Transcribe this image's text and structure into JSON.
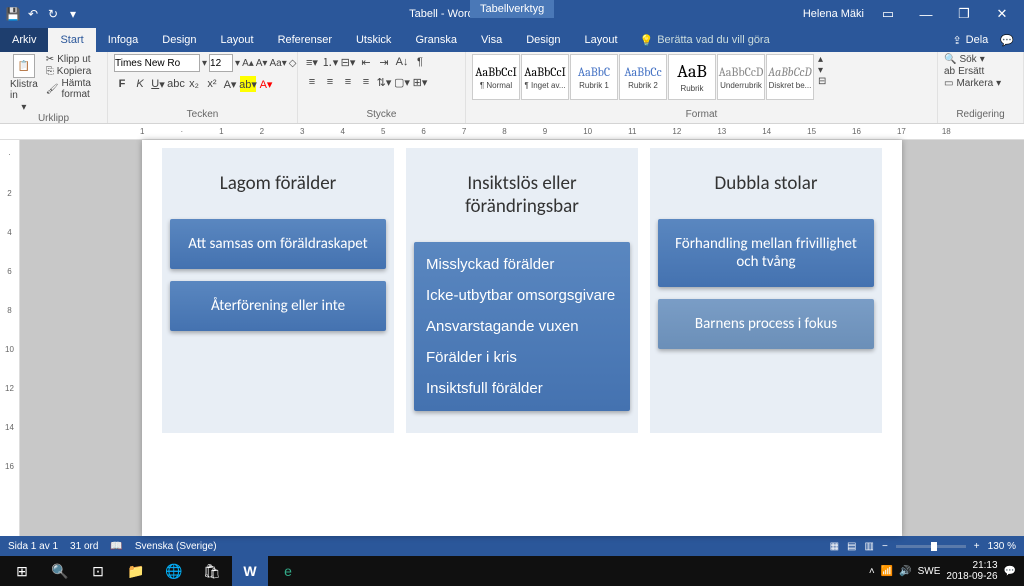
{
  "titlebar": {
    "doc_title": "Tabell - Word",
    "table_tools": "Tabellverktyg",
    "user": "Helena Mäki"
  },
  "tabs": {
    "arkiv": "Arkiv",
    "start": "Start",
    "infoga": "Infoga",
    "design": "Design",
    "layout": "Layout",
    "referenser": "Referenser",
    "utskick": "Utskick",
    "granska": "Granska",
    "visa": "Visa",
    "design2": "Design",
    "layout2": "Layout",
    "tellme": "Berätta vad du vill göra",
    "share": "Dela"
  },
  "ribbon": {
    "klistra": "Klistra in",
    "klipp": "Klipp ut",
    "kopiera": "Kopiera",
    "hamta": "Hämta format",
    "urklipp": "Urklipp",
    "font_name": "Times New Ro",
    "font_size": "12",
    "tecken": "Tecken",
    "stycke": "Stycke",
    "format": "Format",
    "sok": "Sök",
    "ersatt": "Ersätt",
    "markera": "Markera",
    "redigering": "Redigering",
    "styles": {
      "normal": "¶ Normal",
      "inget": "¶ Inget av...",
      "rubrik1": "Rubrik 1",
      "rubrik2": "Rubrik 2",
      "rubrik": "Rubrik",
      "underrubrik": "Underrubrik",
      "diskret": "Diskret be..."
    }
  },
  "doc": {
    "col1_title": "Lagom förälder",
    "col1_card1": "Att samsas om föräldraskapet",
    "col1_card2": "Återförening eller inte",
    "col2_title": "Insiktslös eller förändringsbar",
    "col2_l1": "Misslyckad förälder",
    "col2_l2": "Icke-utbytbar omsorgsgivare",
    "col2_l3": "Ansvarstagande vuxen",
    "col2_l4": "Förälder i kris",
    "col2_l5": "Insiktsfull förälder",
    "col3_title": "Dubbla stolar",
    "col3_card1": "Förhandling mellan frivillighet och tvång",
    "col3_card2": "Barnens process i fokus"
  },
  "status": {
    "page": "Sida 1 av 1",
    "words": "31 ord",
    "lang": "Svenska (Sverige)",
    "zoom": "130 %"
  },
  "task": {
    "lang": "SWE",
    "time": "21:13",
    "date": "2018-09-26"
  }
}
